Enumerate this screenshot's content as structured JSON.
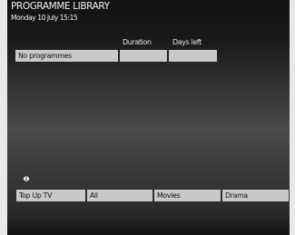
{
  "header": {
    "title": "PROGRAMME LIBRARY",
    "datetime": "Monday 10 July 15:15"
  },
  "table": {
    "columns": [
      "",
      "Duration",
      "Days left"
    ],
    "rows": [
      [
        "No programmes",
        "",
        ""
      ]
    ]
  },
  "navigation": {
    "icon": "left-right-arrows-icon"
  },
  "tabs": [
    {
      "label": "Top Up TV"
    },
    {
      "label": "All"
    },
    {
      "label": "Movies"
    },
    {
      "label": "Drama"
    }
  ]
}
